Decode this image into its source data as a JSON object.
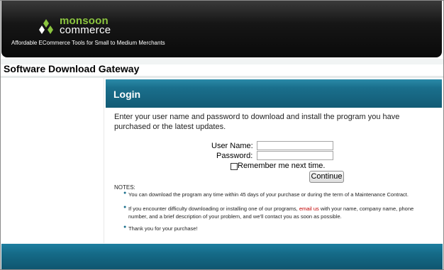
{
  "header": {
    "brand_line1": "monsoon",
    "brand_line2": "commerce",
    "tagline": "Affordable ECommerce Tools for Small to Medium Merchants"
  },
  "page": {
    "title": "Software Download Gateway"
  },
  "login": {
    "title": "Login",
    "intro": "Enter your user name and password to download and install the program you have purchased or the latest updates.",
    "username_label": "User Name:",
    "password_label": "Password:",
    "username_value": "",
    "password_value": "",
    "remember_label": "Remember me next time.",
    "remember_checked": false,
    "submit_label": "Continue"
  },
  "notes": {
    "label": "NOTES:",
    "items": [
      {
        "text": "You can download the program any time within 45 days of your purchase or during the term of a Maintenance Contract."
      },
      {
        "prefix": "If you encounter difficulty downloading or installing one of our programs, ",
        "link": "email us",
        "suffix_line1": " with your name, company name, phone",
        "line2": "number, and a brief description of your problem, and we'll contact you as soon as possible."
      },
      {
        "text": "Thank you for your purchase!"
      }
    ]
  },
  "colors": {
    "header_bg": "#111111",
    "brand_green": "#8bc53f",
    "login_bar": "#1a6f8c",
    "link_red": "#c00000"
  }
}
